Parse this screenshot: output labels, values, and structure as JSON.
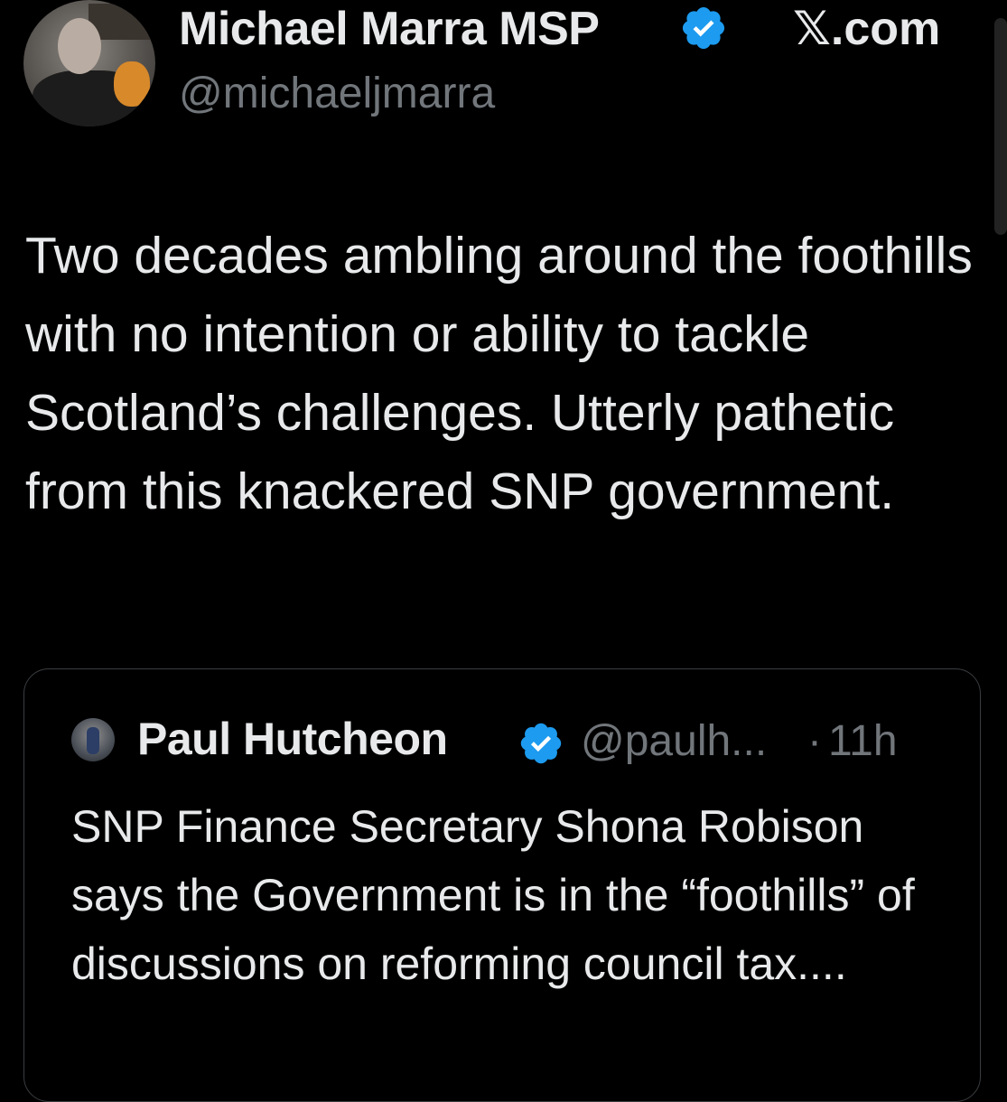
{
  "author": {
    "name": "Michael Marra MSP",
    "handle": "@michaeljmarra",
    "verified": true
  },
  "source_label": "𝕏.com",
  "tweet": {
    "text": "Two decades ambling around the foothills with no intention or ability to tackle Scotland’s challenges. Utterly pathetic from this knackered SNP government."
  },
  "quote": {
    "name": "Paul Hutcheon",
    "handle": "@paulh...",
    "separator": "·",
    "time": "11h",
    "verified": true,
    "text": "SNP Finance Secretary Shona Robison says the Government is in the “foothills” of discussions on reforming council tax...."
  },
  "colors": {
    "background": "#000000",
    "text": "#e7e9ea",
    "muted": "#71767b",
    "verified_badge": "#1d9bf0",
    "border": "#3a3d40"
  },
  "icons": {
    "verified": "verified-badge-icon"
  }
}
